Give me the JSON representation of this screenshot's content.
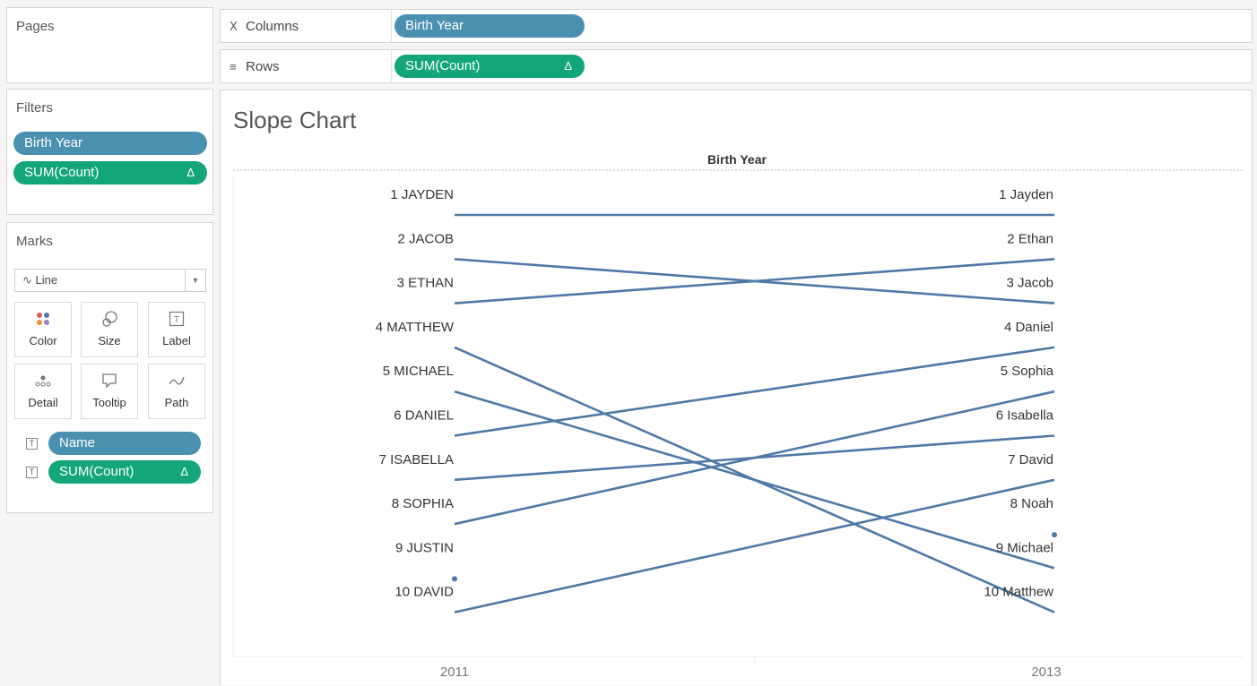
{
  "pages": {
    "title": "Pages"
  },
  "shelves": {
    "columns": {
      "label": "Columns",
      "icon": "columns-icon",
      "pill": "Birth Year"
    },
    "rows": {
      "label": "Rows",
      "icon": "rows-icon",
      "pill": "SUM(Count)",
      "pill_delta": "Δ"
    }
  },
  "filters": {
    "title": "Filters",
    "items": [
      {
        "label": "Birth Year",
        "color": "#4a90b0"
      },
      {
        "label": "SUM(Count)",
        "delta": "Δ",
        "color": "#12a67a"
      }
    ]
  },
  "marks": {
    "title": "Marks",
    "type": "Line",
    "buttons": [
      {
        "label": "Color",
        "icon": "color-icon"
      },
      {
        "label": "Size",
        "icon": "size-icon"
      },
      {
        "label": "Label",
        "icon": "label-icon"
      },
      {
        "label": "Detail",
        "icon": "detail-icon"
      },
      {
        "label": "Tooltip",
        "icon": "tooltip-icon"
      },
      {
        "label": "Path",
        "icon": "path-icon"
      }
    ],
    "fields": [
      {
        "label": "Name",
        "color": "#4a90b0"
      },
      {
        "label": "SUM(Count)",
        "delta": "Δ",
        "color": "#12a67a"
      }
    ]
  },
  "chart_data": {
    "type": "line",
    "title": "Slope Chart",
    "xlabel": "Birth Year",
    "x": [
      "2011",
      "2013"
    ],
    "ylabel": "",
    "grid": false,
    "line_color": "#4e79a7",
    "left_labels": [
      "1 JAYDEN",
      "2 JACOB",
      "3 ETHAN",
      "4 MATTHEW",
      "5 MICHAEL",
      "6 DANIEL",
      "7 ISABELLA",
      "8 SOPHIA",
      "9 JUSTIN",
      "10 DAVID"
    ],
    "right_labels": [
      "1 Jayden",
      "2 Ethan",
      "3 Jacob",
      "4 Daniel",
      "5 Sophia",
      "6 Isabella",
      "7 David",
      "8 Noah",
      "9 Michael",
      "10 Matthew"
    ],
    "series": [
      {
        "name": "Jayden",
        "ranks": [
          1,
          1
        ]
      },
      {
        "name": "Jacob",
        "ranks": [
          2,
          3
        ]
      },
      {
        "name": "Ethan",
        "ranks": [
          3,
          2
        ]
      },
      {
        "name": "Matthew",
        "ranks": [
          4,
          10
        ]
      },
      {
        "name": "Michael",
        "ranks": [
          5,
          9
        ]
      },
      {
        "name": "Daniel",
        "ranks": [
          6,
          4
        ]
      },
      {
        "name": "Isabella",
        "ranks": [
          7,
          6
        ]
      },
      {
        "name": "Sophia",
        "ranks": [
          8,
          5
        ]
      },
      {
        "name": "Justin",
        "ranks": [
          9,
          null
        ]
      },
      {
        "name": "David",
        "ranks": [
          10,
          7
        ]
      },
      {
        "name": "Noah",
        "ranks": [
          null,
          8
        ]
      }
    ]
  }
}
